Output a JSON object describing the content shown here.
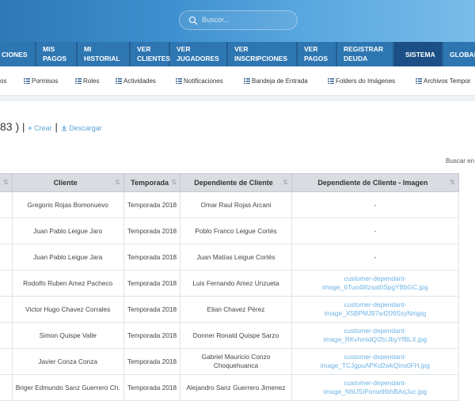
{
  "search": {
    "placeholder": "Buscor..."
  },
  "nav": {
    "tabs": [
      {
        "lines": [
          "CIONES"
        ]
      },
      {
        "lines": [
          "MIS",
          "PAGOS"
        ]
      },
      {
        "lines": [
          "MI",
          "HISTORIAL"
        ]
      },
      {
        "lines": [
          "VER",
          "CLIENTES"
        ]
      },
      {
        "lines": [
          "VER",
          "JUGADORES"
        ]
      },
      {
        "lines": [
          "VER",
          "INSCRIPCIONES"
        ]
      },
      {
        "lines": [
          "VER",
          "PAGOS"
        ]
      },
      {
        "lines": [
          "REGISTRAR",
          "DEUDA"
        ]
      },
      {
        "lines": [
          "SISTEMA"
        ],
        "active": true
      },
      {
        "lines": [
          "GLOBAL"
        ]
      }
    ]
  },
  "subnav": [
    "os",
    "Pormisos",
    "Roles",
    "Actividades",
    "Notificaciones",
    "Bandeja de Entrada",
    "Folders do Imágenes",
    "Archivos Tempor"
  ],
  "title": {
    "count_text": "83 )",
    "separator": "|",
    "crear_label": "Crear",
    "descargar_label": "Descargar"
  },
  "buscar_label": "Buscar en",
  "table": {
    "headers": [
      "",
      "Cliente",
      "Temporada",
      "Dependiente de Cliente",
      "Dependiente de Cliente - Imagen"
    ],
    "rows": [
      {
        "cliente": "Gregorio Rojas Bomonuevo",
        "temporada": "Temporada 2018",
        "dependiente": "Omar Raul Rojas Arcani",
        "imagen": "-"
      },
      {
        "cliente": "Juan Pablo Leigue Jaro",
        "temporada": "Temporada 2018",
        "dependiente": "Poblo Franco Leigue Cortés",
        "imagen": "-"
      },
      {
        "cliente": "Juan Pablo Leigue Jara",
        "temporada": "Temporada 2018",
        "dependiente": "Juan Matías Leigue Cortés",
        "imagen": "-"
      },
      {
        "cliente": "Rodolfo Ruben Amez Pacheco",
        "temporada": "Temporada 2018",
        "dependiente": "Luis Fernando Amez Unzueta",
        "imagen": "customer-dependant-image_6Tuo48Izsat0SpgYBbGC.jpg"
      },
      {
        "cliente": "Victor Hugo Chavez Corrales",
        "temporada": "Temporada 2018",
        "dependiente": "Elian Chavez Pérez",
        "imagen": "customer-dependant-image_X5BPMJ97wI209SsyNmjpg"
      },
      {
        "cliente": "Simon Quispe Valle",
        "temporada": "Temporada 2018",
        "dependiente": "Donner Ronald Quispe Sarzo",
        "imagen": "customer-dependant-image_RKvhmidQI2tcJbyYfBLX.jpg"
      },
      {
        "cliente": "Javier Conza Conza",
        "temporada": "Temporada 2018",
        "dependiente": "Gabriel Mauricio Conzo Choquehuanca",
        "imagen": "customer-dependant-image_TCJgpuAPKd2wkQins0FH.jpg"
      },
      {
        "cliente": "Briger Edmundo Sanz Guerrero Ch.",
        "temporada": "Temporada 2018",
        "dependiente": "Alejandro Sanz Guerrero Jimenez",
        "imagen": "customer-dependant-image_N6USIPonw9IbhBArjJuc.jpg"
      }
    ]
  },
  "colors": {
    "header_start": "#2f78b7",
    "header_end": "#79bce9",
    "tab_bg": "#2e76b2",
    "tab_active": "#1b4f86",
    "link": "#6fb3e4"
  }
}
